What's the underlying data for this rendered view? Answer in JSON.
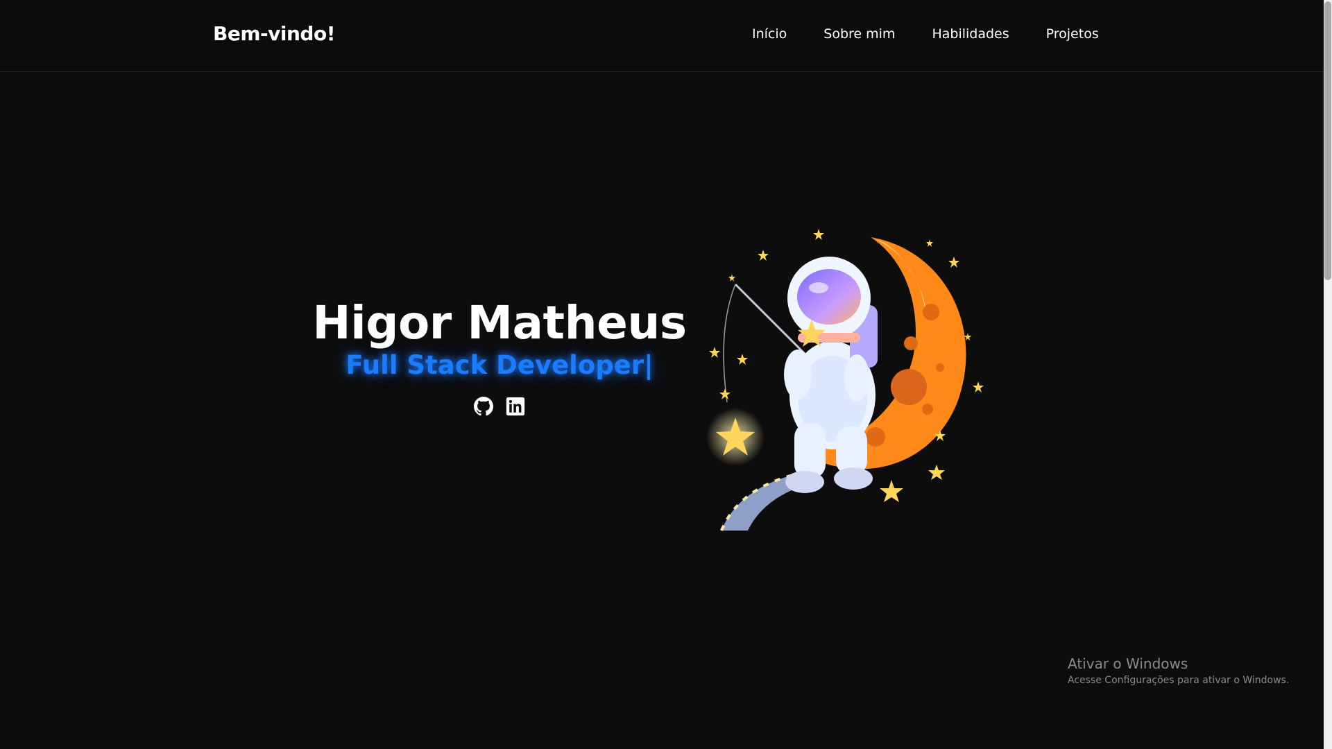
{
  "header": {
    "brand": "Bem-vindo!",
    "nav": [
      {
        "label": "Início"
      },
      {
        "label": "Sobre mim"
      },
      {
        "label": "Habilidades"
      },
      {
        "label": "Projetos"
      }
    ]
  },
  "hero": {
    "name": "Higor Matheus",
    "role": "Full Stack Developer|",
    "socials": [
      {
        "icon": "github-icon"
      },
      {
        "icon": "linkedin-icon"
      }
    ],
    "illustration": "astronaut-on-moon"
  },
  "watermark": {
    "title": "Ativar o Windows",
    "subtitle": "Acesse Configurações para ativar o Windows."
  },
  "colors": {
    "background": "#0d0d0d",
    "accent": "#1a7cff",
    "moon": "#ff8a1a"
  }
}
